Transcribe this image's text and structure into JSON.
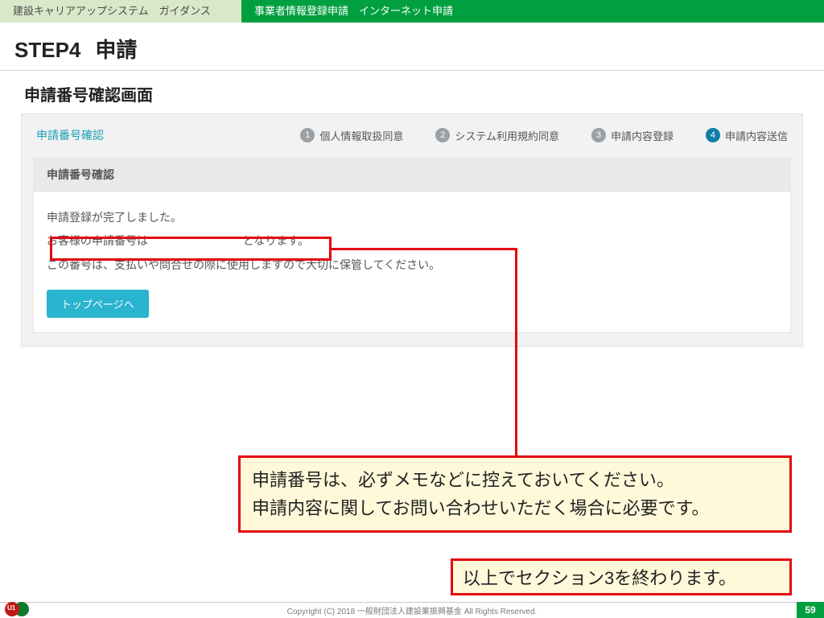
{
  "topbar": {
    "left": "建設キャリアアップシステム　ガイダンス",
    "right": "事業者情報登録申請　インターネット申請"
  },
  "step": {
    "no": "STEP4",
    "label": "申請"
  },
  "section_title": "申請番号確認画面",
  "wizard": {
    "current_step_label": "申請番号確認",
    "steps": [
      {
        "n": "1",
        "label": "個人情報取扱同意"
      },
      {
        "n": "2",
        "label": "システム利用規約同意"
      },
      {
        "n": "3",
        "label": "申請内容登録"
      },
      {
        "n": "4",
        "label": "申請内容送信"
      }
    ],
    "active_index": 3
  },
  "card": {
    "header": "申請番号確認",
    "line1": "申請登録が完了しました。",
    "line2_prefix": "お客様の申請番号は",
    "line2_suffix": "となります。",
    "line3": "この番号は、支払いや問合せの際に使用しますので大切に保管してください。",
    "home_button": "トップページへ"
  },
  "callout1": {
    "line1": "申請番号は、必ずメモなどに控えておいてください。",
    "line2": "申請内容に関してお問い合わせいただく場合に必要です。"
  },
  "callout2": "以上でセクション3を終わります。",
  "footer": {
    "copyright": "Copyright (C) 2018 一般財団法人建設業振興基金 All Rights Reserved.",
    "page": "59"
  }
}
